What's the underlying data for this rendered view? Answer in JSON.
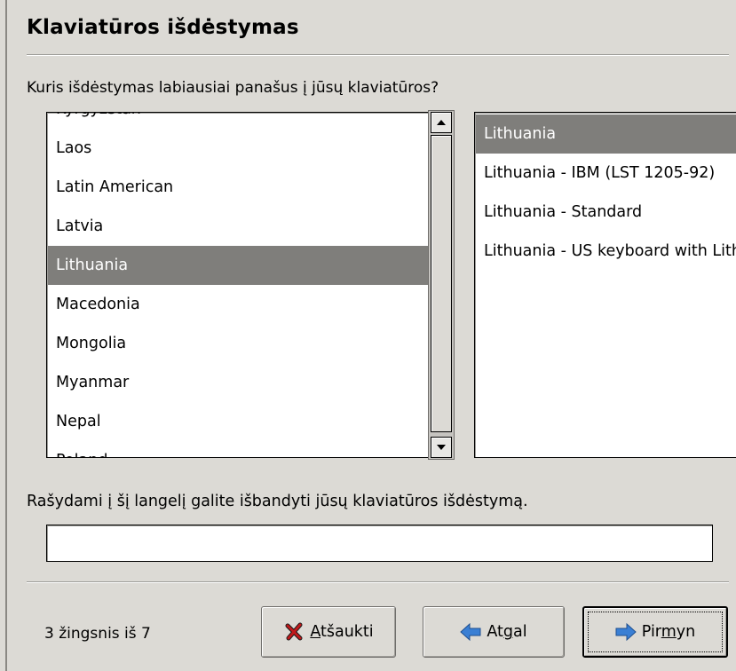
{
  "page": {
    "title": "Klaviatūros išdėstymas",
    "question": "Kuris išdėstymas labiausiai panašus į jūsų klaviatūros?",
    "hint": "Rašydami į šį langelį galite išbandyti jūsų klaviatūros išdėstymą.",
    "step": "3 žingsnis iš 7"
  },
  "countries": [
    {
      "label": "Kyrgyzstan",
      "selected": false
    },
    {
      "label": "Laos",
      "selected": false
    },
    {
      "label": "Latin American",
      "selected": false
    },
    {
      "label": "Latvia",
      "selected": false
    },
    {
      "label": "Lithuania",
      "selected": true
    },
    {
      "label": "Macedonia",
      "selected": false
    },
    {
      "label": "Mongolia",
      "selected": false
    },
    {
      "label": "Myanmar",
      "selected": false
    },
    {
      "label": "Nepal",
      "selected": false
    },
    {
      "label": "Poland",
      "selected": false
    }
  ],
  "variants": [
    {
      "label": "Lithuania",
      "selected": true
    },
    {
      "label": "Lithuania - IBM (LST 1205-92)",
      "selected": false
    },
    {
      "label": "Lithuania - Standard",
      "selected": false
    },
    {
      "label": "Lithuania - US keyboard with Lithuanian letters",
      "selected": false
    }
  ],
  "test_input": {
    "value": ""
  },
  "buttons": {
    "cancel": {
      "prefix": "",
      "mnemonic": "A",
      "rest": "tšaukti",
      "icon": "x-icon"
    },
    "back": {
      "prefix": "At",
      "mnemonic": "g",
      "rest": "al",
      "icon": "arrow-left-icon"
    },
    "forward": {
      "prefix": "Pir",
      "mnemonic": "m",
      "rest": "yn",
      "icon": "arrow-right-icon"
    }
  },
  "colors": {
    "selection": "#7f7e7b",
    "arrow_blue": "#3a7fd4",
    "cancel_red": "#c0191b"
  }
}
